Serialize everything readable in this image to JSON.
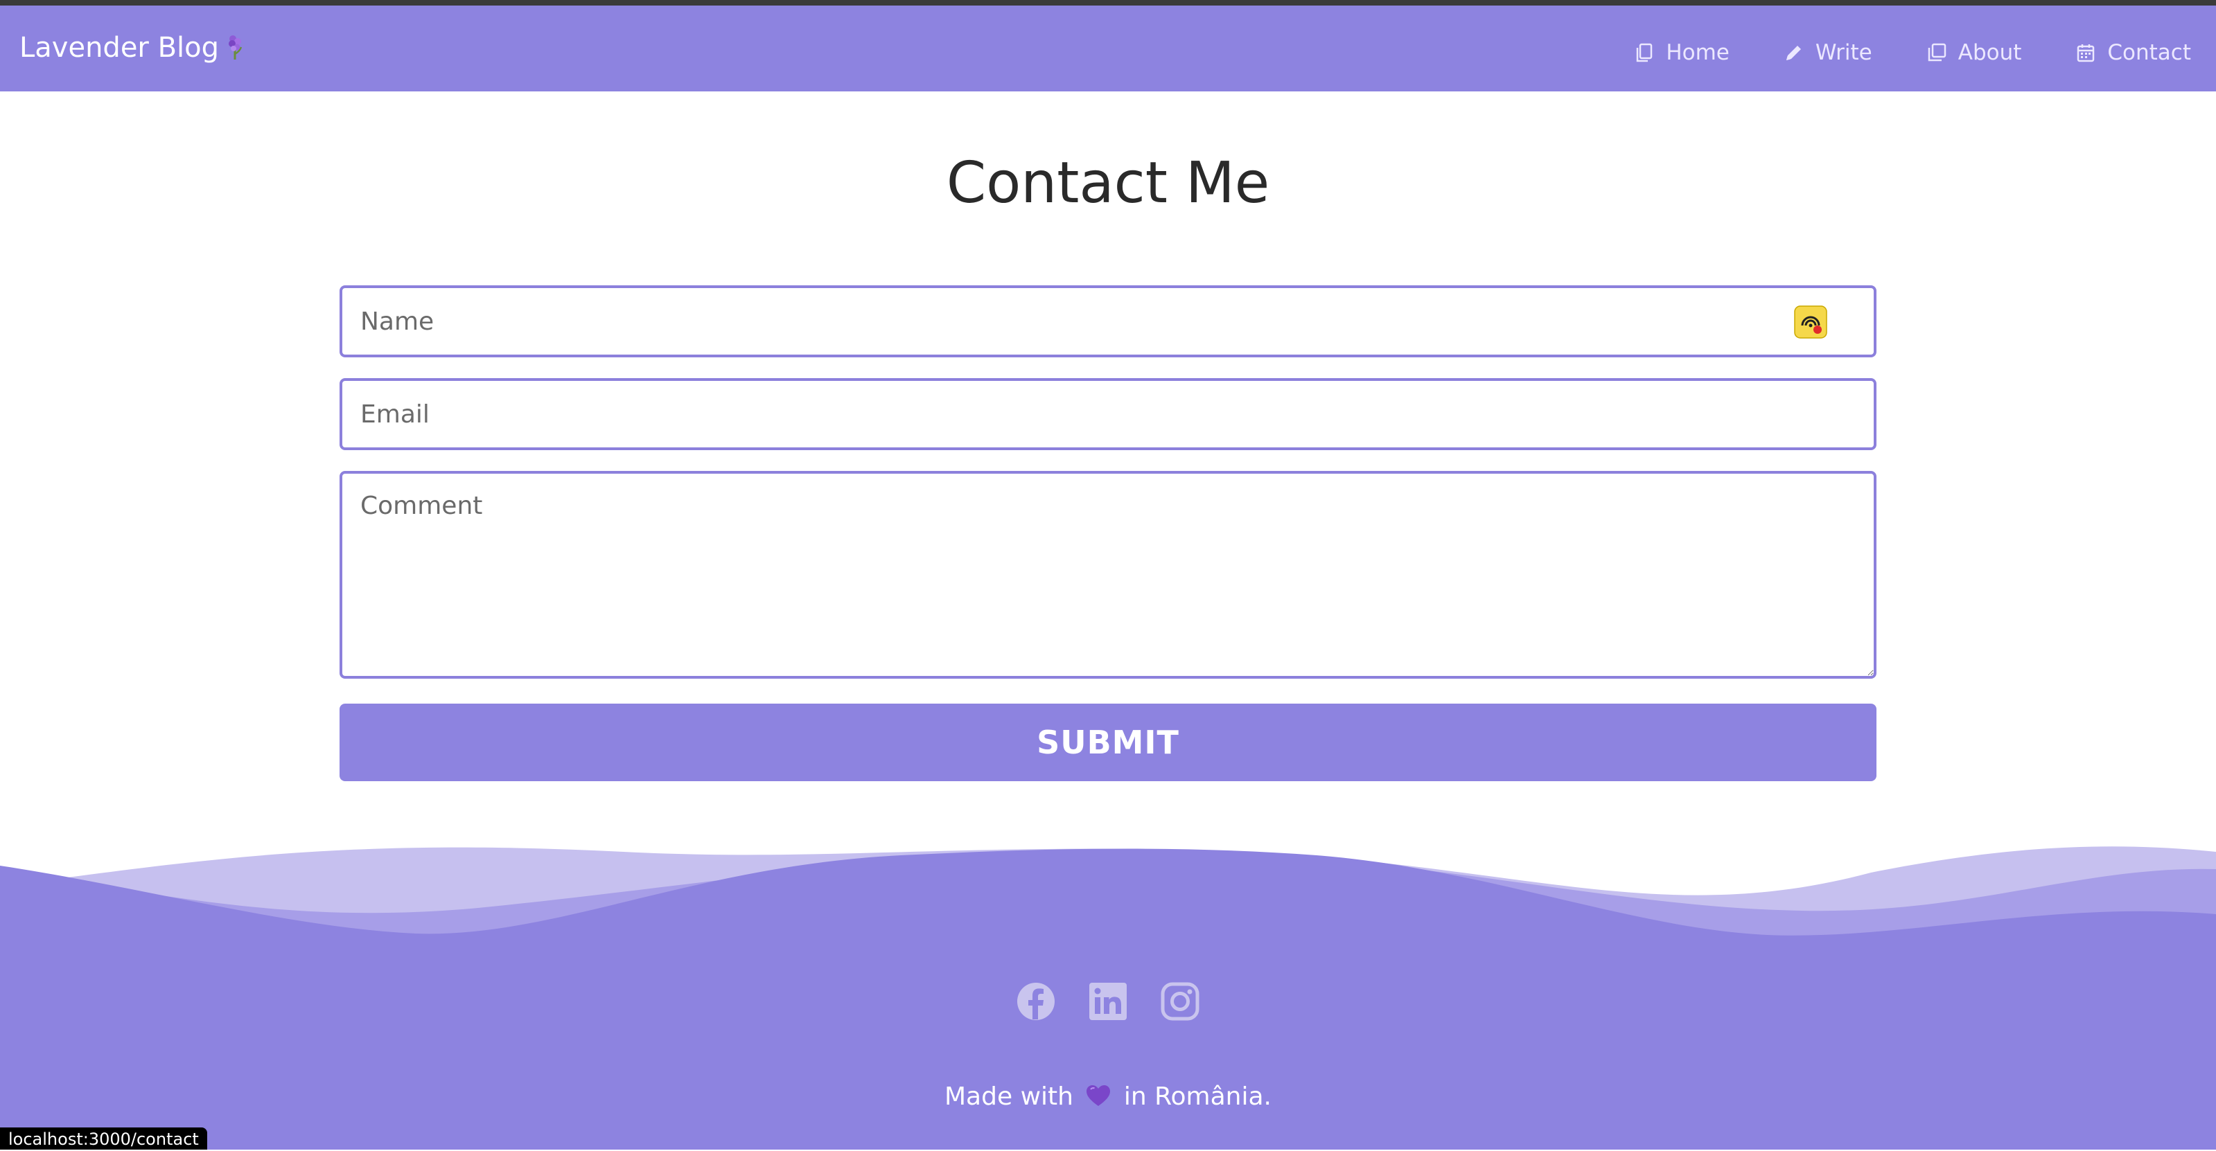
{
  "colors": {
    "brand": "#8d83e0",
    "field_border": "#8c80dc",
    "wave_light": "#c6c0ef",
    "wave_mid": "#a79ee8"
  },
  "navbar": {
    "brand_text": "Lavender Blog",
    "brand_icon": "lavender-flower-emoji",
    "links": [
      {
        "label": "Home",
        "icon": "copy-icon"
      },
      {
        "label": "Write",
        "icon": "pencil-icon"
      },
      {
        "label": "About",
        "icon": "square-stack-icon"
      },
      {
        "label": "Contact",
        "icon": "calendar-icon"
      }
    ]
  },
  "main": {
    "title": "Contact Me",
    "form": {
      "name_placeholder": "Name",
      "email_placeholder": "Email",
      "comment_placeholder": "Comment",
      "submit_label": "SUBMIT"
    }
  },
  "footer": {
    "socials": [
      "facebook-icon",
      "linkedin-icon",
      "instagram-icon"
    ],
    "made_with_prefix": "Made with",
    "made_with_suffix": "in România."
  },
  "status_bar": {
    "url": "localhost:3000/contact"
  }
}
